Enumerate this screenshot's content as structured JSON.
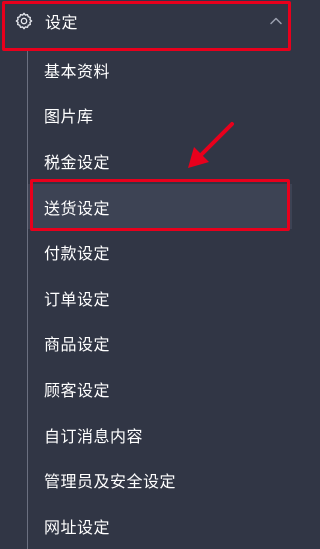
{
  "section": {
    "title": "设定",
    "icon": "gear-icon",
    "expanded_icon": "chevron-up-icon"
  },
  "menu": {
    "items": [
      {
        "label": "基本资料"
      },
      {
        "label": "图片库"
      },
      {
        "label": "税金设定"
      },
      {
        "label": "送货设定"
      },
      {
        "label": "付款设定"
      },
      {
        "label": "订单设定"
      },
      {
        "label": "商品设定"
      },
      {
        "label": "顾客设定"
      },
      {
        "label": "自订消息内容"
      },
      {
        "label": "管理员及安全设定"
      },
      {
        "label": "网址设定"
      }
    ],
    "active_index": 3
  },
  "annotations": {
    "highlight_color": "#e8001c",
    "arrow_icon": "arrow-pointer-icon"
  },
  "colors": {
    "background": "#313645",
    "text": "#ffffff",
    "tree_line": "#6b7080"
  }
}
